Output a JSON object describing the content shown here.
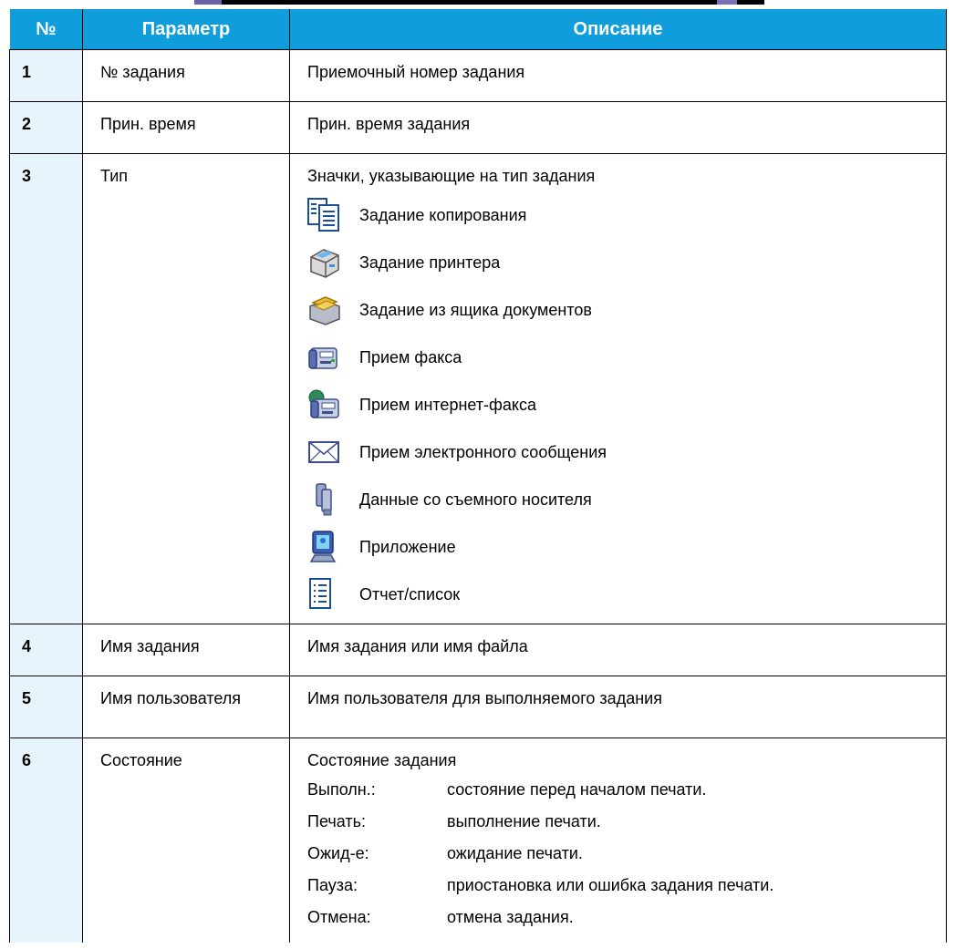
{
  "header": {
    "no": "№",
    "param": "Параметр",
    "desc": "Описание"
  },
  "rows": [
    {
      "no": "1",
      "param": "№ задания",
      "desc": "Приемочный номер задания"
    },
    {
      "no": "2",
      "param": "Прин. время",
      "desc": "Прин. время задания"
    },
    {
      "no": "3",
      "param": "Тип",
      "desc": "Значки, указывающие на тип задания",
      "icons": [
        {
          "icon": "copy-job-icon",
          "label": "Задание копирования"
        },
        {
          "icon": "printer-job-icon",
          "label": "Задание принтера"
        },
        {
          "icon": "document-box-job-icon",
          "label": "Задание из ящика документов"
        },
        {
          "icon": "fax-receive-icon",
          "label": "Прием факса"
        },
        {
          "icon": "internet-fax-receive-icon",
          "label": "Прием интернет-факса"
        },
        {
          "icon": "email-receive-icon",
          "label": "Прием электронного сообщения"
        },
        {
          "icon": "removable-memory-icon",
          "label": "Данные со съемного носителя"
        },
        {
          "icon": "application-icon",
          "label": "Приложение"
        },
        {
          "icon": "report-list-icon",
          "label": "Отчет/список"
        }
      ]
    },
    {
      "no": "4",
      "param": "Имя задания",
      "desc": "Имя задания или имя файла"
    },
    {
      "no": "5",
      "param": "Имя пользователя",
      "desc": "Имя пользователя для выполняемого задания"
    },
    {
      "no": "6",
      "param": "Состояние",
      "desc": "Состояние задания",
      "states": [
        {
          "key": "Выполн.:",
          "value": "состояние перед началом печати."
        },
        {
          "key": "Печать:",
          "value": "выполнение печати."
        },
        {
          "key": "Ожид-е:",
          "value": "ожидание печати."
        },
        {
          "key": "Пауза:",
          "value": "приостановка или ошибка задания печати."
        },
        {
          "key": "Отмена:",
          "value": "отмена задания."
        }
      ]
    }
  ],
  "colors": {
    "header_bg": "#0f9ddb",
    "number_cell_bg": "#e8f4fb"
  }
}
